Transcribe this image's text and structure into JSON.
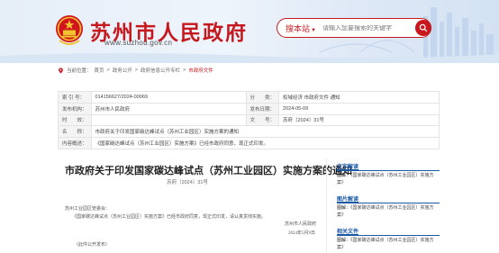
{
  "header": {
    "site_name": "苏州市人民政府",
    "site_url": "www.suzhou.gov.cn",
    "search_scope": "搜本站",
    "search_placeholder": "请输入您要搜索的关键字",
    "brand_color": "#c6191f"
  },
  "breadcrumb": {
    "prefix": "当前位置：",
    "items": [
      "首页",
      "政务公开",
      "政府信息公开专栏",
      "市政府文件"
    ],
    "separator": ">"
  },
  "meta": {
    "rows": [
      {
        "k1": "索 引 号：",
        "v1": "014156627/2024-00069",
        "k2": "分　　类：",
        "v2": "权域经济 市政府文件 通知"
      },
      {
        "k1": "发布机构：",
        "v1": "苏州市人民政府",
        "k2": "发布日期：",
        "v2": "2024-05-09"
      },
      {
        "k1": "时　　效：",
        "v1": "",
        "k2": "文　　号：",
        "v2": "苏府〔2024〕31号"
      }
    ],
    "name_label": "名　　称：",
    "name_value": "市政府关于印发国家碳达峰试点（苏州工业园区）实施方案的通知",
    "summary_label": "内容概述：",
    "summary_value": "《国家碳达峰试点（苏州工业园区）实施方案》已经市政府同意，现正式印发。"
  },
  "document": {
    "title": "市政府关于印发国家碳达峰试点（苏州工业园区）实施方案的通知",
    "number": "苏府〔2024〕31号",
    "salutation": "苏州工业园区管委会：",
    "body": "《国家碳达峰试点（苏州工业园区）实施方案》已经市政府同意，现正式印发，请认真贯彻实施。",
    "signer": "苏州市人民政府",
    "date": "2024年5月9日",
    "note": "（此件公开发布）"
  },
  "sidebar": {
    "sections": [
      {
        "heading": "文字解读",
        "label": "图解：",
        "text": "《国家碳达峰试点（苏州工业园区）实施方案》"
      },
      {
        "heading": "图片解读",
        "label": "图解：",
        "text": "《国家碳达峰试点（苏州工业园区）实施方案》"
      },
      {
        "heading": "相关文件",
        "label": "图解：",
        "text": "《国家碳达峰试点（苏州工业园区）实施方案》"
      }
    ],
    "accent_color": "#1a59a6"
  }
}
